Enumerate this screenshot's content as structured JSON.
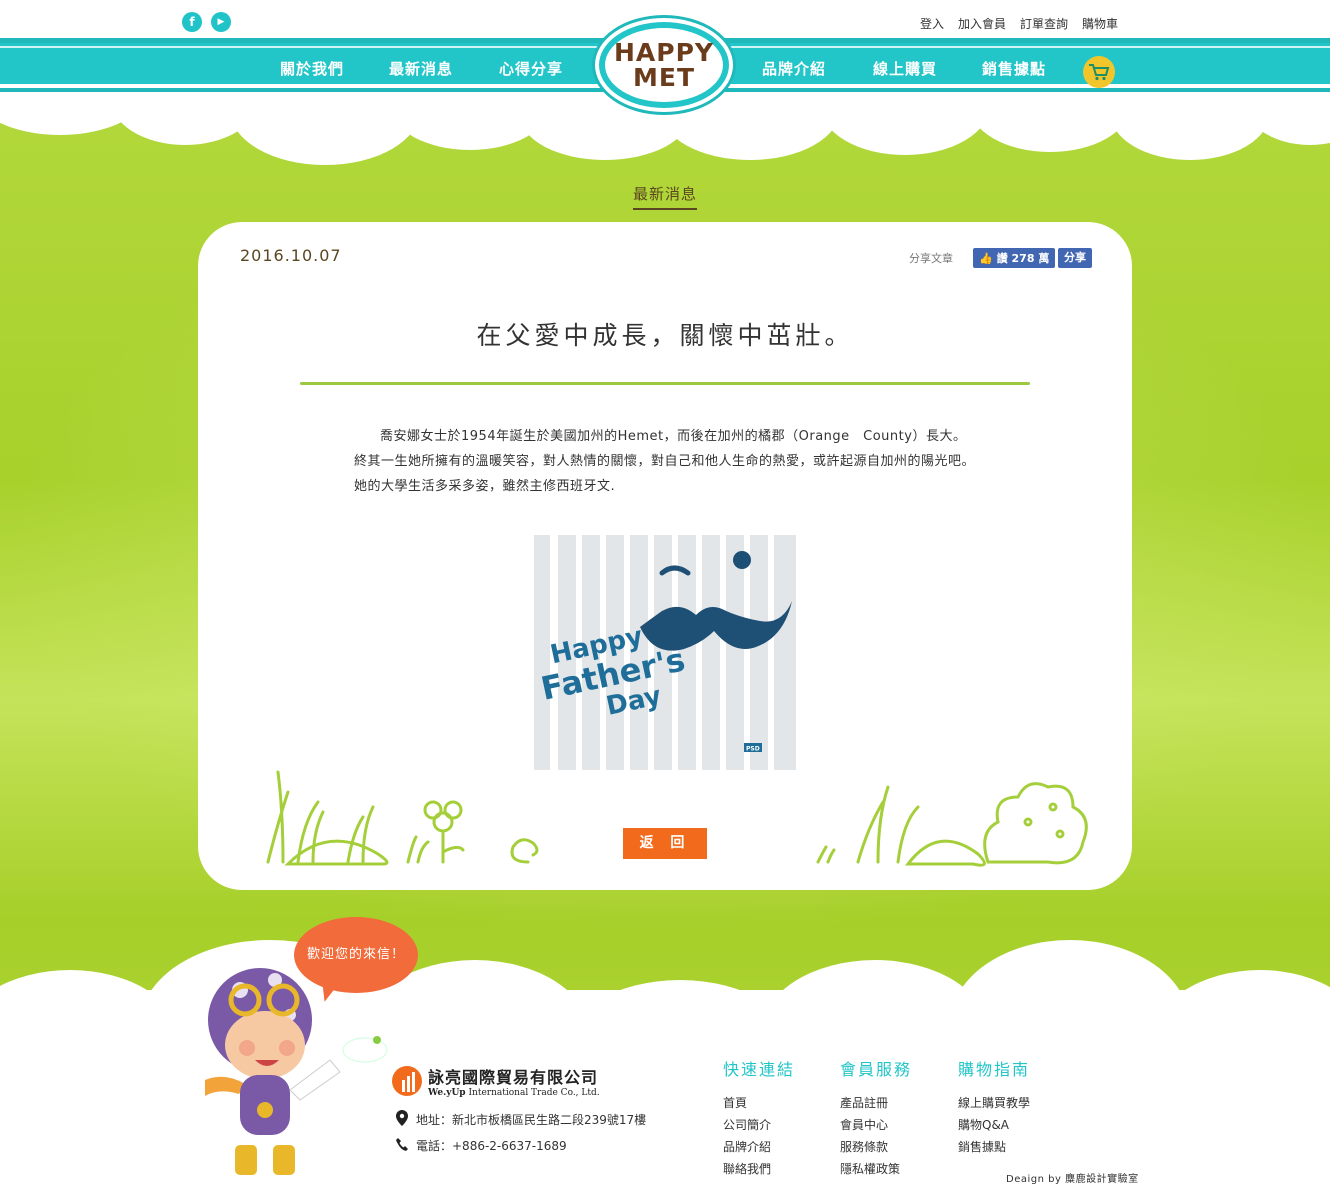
{
  "header": {
    "social": [
      "f",
      "▶"
    ],
    "top_links": [
      "登入",
      "加入會員",
      "訂單查詢",
      "購物車"
    ],
    "nav_left": [
      "關於我們",
      "最新消息",
      "心得分享"
    ],
    "nav_right": [
      "品牌介紹",
      "線上購買",
      "銷售據點"
    ],
    "logo_line1": "HAPPY",
    "logo_line2": "MET"
  },
  "section_title": "最新消息",
  "article": {
    "date": "2016.10.07",
    "share_label": "分享文章",
    "like_label": "讚 278 萬",
    "share_button": "分享",
    "title": "在父愛中成長，關懷中茁壯。",
    "body": "喬安娜女士於1954年誕生於美國加州的Hemet，而後在加州的橘郡（Orange　County）長大。終其一生她所擁有的溫暖笑容，對人熱情的關懷，對自己和他人生命的熱愛，或許起源自加州的陽光吧。她的大學生活多采多姿，雖然主修西班牙文.",
    "poster": {
      "line1": "Happy",
      "line2": "Father's",
      "line3": "Day",
      "tag": "PSD"
    },
    "back_button": "返 回"
  },
  "footer": {
    "bubble": "歡迎您的來信！",
    "company_name": "詠亮國際貿易有限公司",
    "company_en_brand": "We.yUp",
    "company_en": "International Trade Co., Ltd.",
    "address": "地址：新北市板橋區民生路二段239號17樓",
    "phone": "電話：+886-2-6637-1689",
    "columns": [
      {
        "title": "快速連結",
        "items": [
          "首頁",
          "公司簡介",
          "品牌介紹",
          "聯絡我們"
        ]
      },
      {
        "title": "會員服務",
        "items": [
          "產品註冊",
          "會員中心",
          "服務條款",
          "隱私權政策"
        ]
      },
      {
        "title": "購物指南",
        "items": [
          "線上購買教學",
          "購物Q&A",
          "銷售據點"
        ]
      }
    ],
    "design_credit": "Deaign by 麋鹿設計實驗室"
  },
  "colors": {
    "teal": "#22c5c8",
    "green": "#a8d12c",
    "orange": "#f26b1d",
    "brown": "#5a4620",
    "navy": "#1e4f75"
  }
}
